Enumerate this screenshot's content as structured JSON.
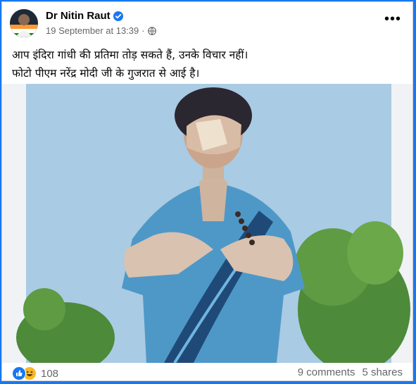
{
  "post": {
    "author": "Dr Nitin Raut",
    "timestamp": "19 September at 13:39",
    "separator": "·",
    "privacy_icon": "globe-icon",
    "verified_icon": "verified-badge-icon",
    "more_icon": "more-options-icon",
    "more_label": "•••",
    "text_line1": "आप इंदिरा गांधी की प्रतिमा तोड़ सकते हैं, उनके विचार नहीं।",
    "text_line2": "फोटो पीएम नरेंद्र मोदी जी के गुजरात से आई है।",
    "image_subject": "damaged statue of Indira Gandhi in blue saree against sky and trees"
  },
  "footer": {
    "reaction_icons": [
      "like-icon",
      "haha-icon"
    ],
    "reaction_count": "108",
    "comments": "9 comments",
    "shares": "5 shares"
  },
  "colors": {
    "frame": "#1877f2",
    "text_primary": "#050505",
    "text_secondary": "#65676b",
    "sky": "#a9cbe3",
    "saree": "#4e98c8"
  }
}
